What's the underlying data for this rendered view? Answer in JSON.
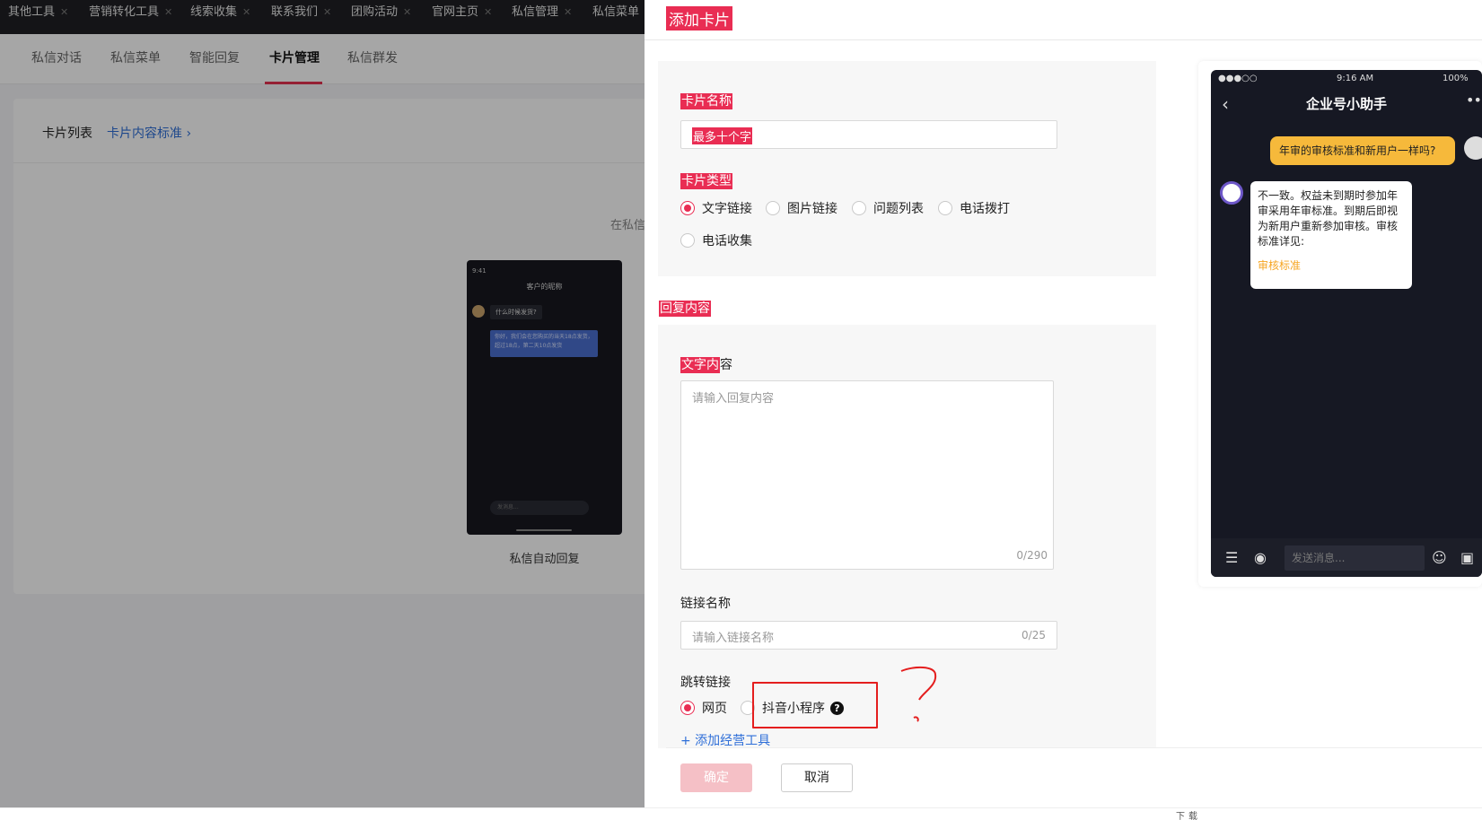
{
  "background": {
    "top_tabs": [
      "其他工具",
      "营销转化工具",
      "线索收集",
      "联系我们",
      "团购活动",
      "官网主页",
      "私信管理",
      "私信菜单"
    ],
    "sub_tabs": [
      "私信对话",
      "私信菜单",
      "智能回复",
      "卡片管理",
      "私信群发"
    ],
    "active_sub_tab": "卡片管理",
    "card_list_label": "卡片列表",
    "card_standard_link": "卡片内容标准",
    "partial_text": "在私信",
    "phone": {
      "time": "9:41",
      "title": "客户的昵称",
      "msg1": "什么时候发货?",
      "msg2": "你好，我们会在您购买的当天18点发货，超过18点，第二天10点发货",
      "input_placeholder": "发消息..."
    },
    "phone_caption": "私信自动回复"
  },
  "drawer": {
    "title": "添加卡片",
    "card_name_label": "卡片名称",
    "card_name_placeholder": "最多十个字",
    "card_type_label": "卡片类型",
    "card_types": [
      "文字链接",
      "图片链接",
      "问题列表",
      "电话拨打",
      "电话收集"
    ],
    "card_type_selected": "文字链接",
    "reply_section_label": "回复内容",
    "text_content_label_hl": "文字内",
    "text_content_label_rest": "容",
    "text_content_placeholder": "请输入回复内容",
    "text_counter": "0/290",
    "link_name_label": "链接名称",
    "link_name_placeholder": "请输入链接名称",
    "link_counter": "0/25",
    "jump_link_label": "跳转链接",
    "jump_options": [
      "网页",
      "抖音小程序"
    ],
    "jump_selected": "网页",
    "add_tool": "+ 添加经营工具",
    "ok_label": "确定",
    "cancel_label": "取消"
  },
  "preview": {
    "status_left": "●●●○○",
    "time": "9:16 AM",
    "battery": "100%",
    "title": "企业号小助手",
    "question": "年审的审核标准和新用户一样吗?",
    "answer": "不一致。权益未到期时参加年审采用年审标准。到期后即视为新用户重新参加审核。审核标准详见:",
    "answer_link": "审核标准",
    "input_placeholder": "发送消息..."
  },
  "taskbar_text": "下载",
  "colors": {
    "accent": "#e92d53",
    "link": "#2f6fd8",
    "bubble": "#f6b93b",
    "annotation": "#e41e1e"
  }
}
